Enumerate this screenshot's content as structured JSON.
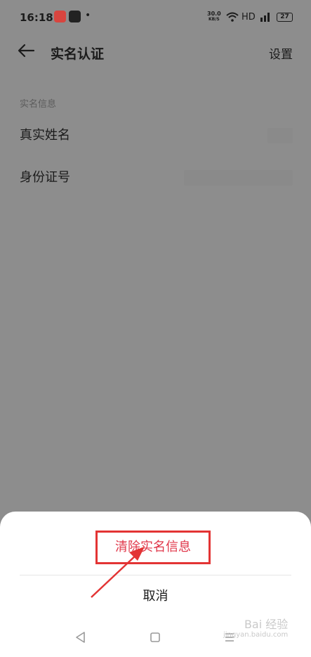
{
  "status_bar": {
    "time": "16:18",
    "dot": "•",
    "net_speed": "30.0",
    "net_unit": "KB/S",
    "hd": "HD",
    "battery": "27"
  },
  "header": {
    "title": "实名认证",
    "settings_label": "设置",
    "back_icon": "arrow-left-icon"
  },
  "section": {
    "label": "实名信息",
    "rows": [
      {
        "label": "真实姓名"
      },
      {
        "label": "身份证号"
      }
    ]
  },
  "sheet": {
    "primary_label": "清除实名信息",
    "cancel_label": "取消"
  },
  "watermark": {
    "line1": "Bai 经验",
    "line2": "jingyan.baidu.com"
  },
  "colors": {
    "overlay": "#8d8d8d",
    "danger": "#e0374a",
    "annotation": "#e33434"
  }
}
